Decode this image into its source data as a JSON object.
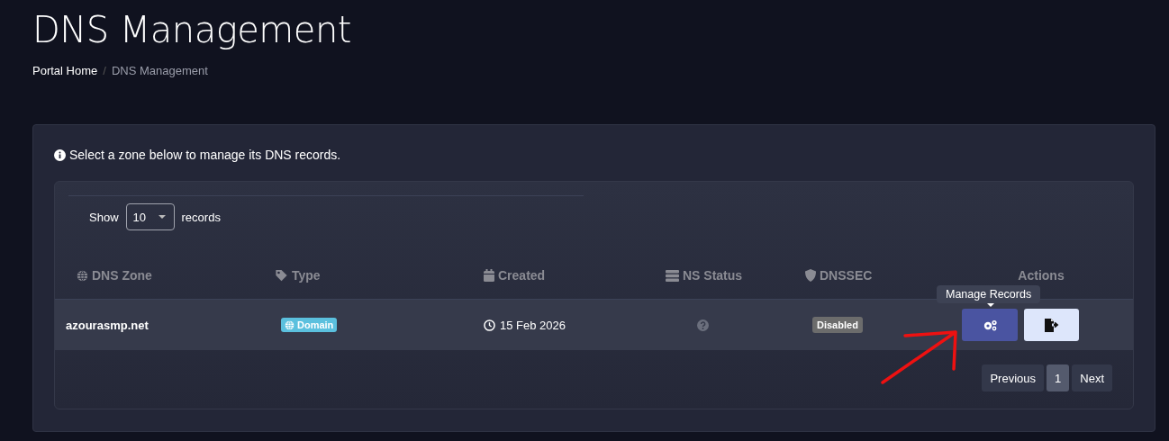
{
  "page": {
    "title": "DNS Management",
    "breadcrumb": [
      {
        "label": "Portal Home",
        "kind": "link"
      },
      {
        "label": "/",
        "kind": "separator"
      },
      {
        "label": "DNS Management",
        "kind": "current"
      }
    ]
  },
  "info": "Select a zone below to manage its DNS records.",
  "length_menu": {
    "prefix": "Show",
    "value": "10",
    "suffix": "records"
  },
  "table": {
    "columns": [
      {
        "label": "DNS Zone"
      },
      {
        "label": "Type"
      },
      {
        "label": "Created"
      },
      {
        "label": "NS Status"
      },
      {
        "label": "DNSSEC"
      },
      {
        "label": "Actions"
      }
    ],
    "rows": [
      {
        "zone": "azourasmp.net",
        "type": "Domain",
        "created": "15 Feb 2026",
        "dnssec": "Disabled"
      }
    ]
  },
  "tooltip": "Manage Records",
  "pagination": [
    {
      "label": "Previous",
      "selected": false
    },
    {
      "label": "1",
      "selected": true
    },
    {
      "label": "Next",
      "selected": false
    }
  ]
}
